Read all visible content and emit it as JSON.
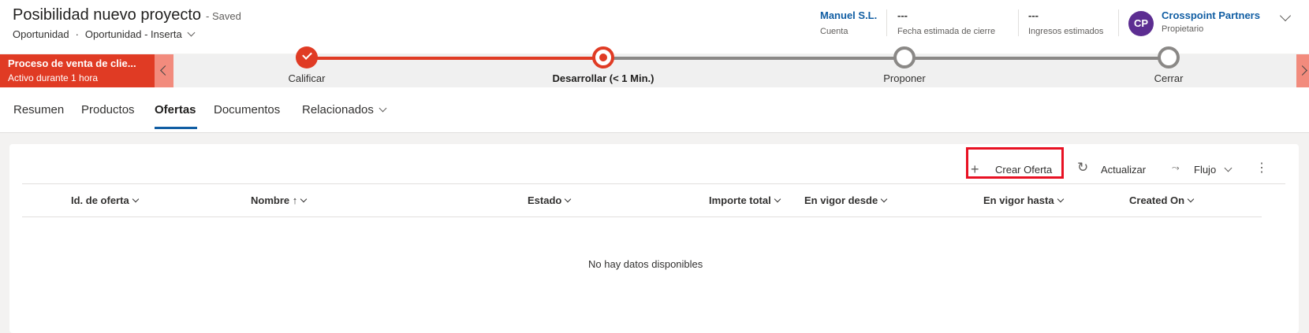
{
  "header": {
    "title": "Posibilidad nuevo proyecto",
    "saved": "- Saved",
    "entity": "Oportunidad",
    "separator": "·",
    "form": "Oportunidad - Inserta",
    "fields": [
      {
        "value": "Manuel S.L.",
        "label": "Cuenta"
      },
      {
        "value": "---",
        "label": "Fecha estimada de cierre"
      },
      {
        "value": "---",
        "label": "Ingresos estimados"
      }
    ],
    "owner": {
      "initials": "CP",
      "name": "Crosspoint Partners",
      "role": "Propietario"
    }
  },
  "bpf": {
    "process_name": "Proceso de venta de clie...",
    "process_status": "Activo durante 1 hora",
    "stages": [
      {
        "label": "Calificar",
        "state": "done"
      },
      {
        "label": "Desarrollar  (< 1 Min.)",
        "state": "active"
      },
      {
        "label": "Proponer",
        "state": "todo"
      },
      {
        "label": "Cerrar",
        "state": "todo"
      }
    ]
  },
  "tabs": [
    {
      "label": "Resumen"
    },
    {
      "label": "Productos"
    },
    {
      "label": "Ofertas",
      "selected": true
    },
    {
      "label": "Documentos"
    },
    {
      "label": "Relacionados"
    }
  ],
  "commands": {
    "create": "Crear Oferta",
    "refresh": "Actualizar",
    "flow": "Flujo"
  },
  "grid": {
    "columns": [
      "Id. de oferta",
      "Nombre",
      "Estado",
      "Importe total",
      "En vigor desde",
      "En vigor hasta",
      "Created On"
    ],
    "sort_indicator": "↑",
    "empty_message": "No hay datos disponibles"
  },
  "colors": {
    "accent": "#e03b24",
    "link": "#115ea3",
    "avatar": "#5c2d91",
    "highlight": "#e81123"
  }
}
